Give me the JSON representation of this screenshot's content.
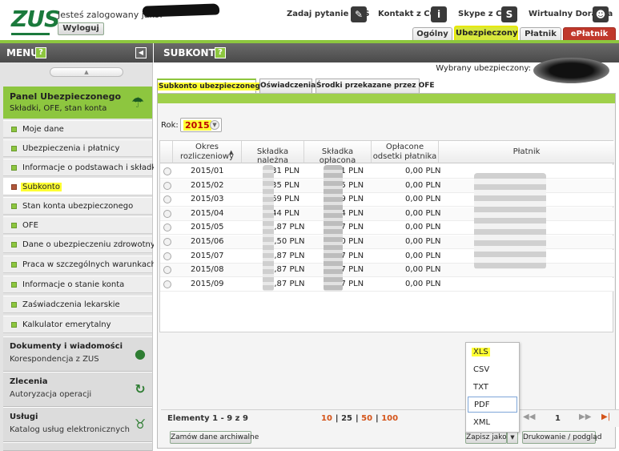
{
  "header": {
    "logo": "ZUS",
    "logged_as": "Jesteś zalogowany jako:",
    "logout": "Wyloguj",
    "links": [
      {
        "label": "Zadaj pytanie ZUS",
        "icon": "chat-icon"
      },
      {
        "label": "Kontakt z COT",
        "icon": "info-icon"
      },
      {
        "label": "Skype z COT",
        "icon": "skype-icon"
      },
      {
        "label": "Wirtualny Doradca",
        "icon": "user-icon"
      }
    ],
    "tabs": [
      "Ogólny",
      "Ubezpieczony",
      "Płatnik",
      "ePłatnik"
    ],
    "active_tab": "Ubezpieczony"
  },
  "menu": {
    "title": "MENU",
    "help": "?",
    "panel": {
      "title": "Panel Ubezpieczonego",
      "subtitle": "Składki, OFE, stan konta",
      "icon": "umbrella-icon"
    },
    "items": [
      "Moje dane",
      "Ubezpieczenia i płatnicy",
      "Informacje o podstawach i składkach",
      "Subkonto",
      "Stan konta ubezpieczonego",
      "OFE",
      "Dane o ubezpieczeniu zdrowotnym",
      "Praca w szczególnych warunkach",
      "Informacje o stanie konta",
      "Zaświadczenia lekarskie",
      "Kalkulator emerytalny"
    ],
    "active_item": "Subkonto",
    "groups": [
      {
        "title": "Dokumenty i wiadomości",
        "subtitle": "Korespondencja z ZUS",
        "icon": "speech-bubble-icon"
      },
      {
        "title": "Zlecenia",
        "subtitle": "Autoryzacja operacji",
        "icon": "refresh-icon"
      },
      {
        "title": "Usługi",
        "subtitle": "Katalog usług elektronicznych",
        "icon": "services-icon"
      }
    ]
  },
  "main": {
    "title": "SUBKONTO",
    "help": "?",
    "selected_label": "Wybrany ubezpieczony:",
    "subtabs": [
      "Subkonto ubezpieczonego *",
      "Oświadczenia",
      "Środki przekazane przez OFE"
    ],
    "rok_label": "Rok:",
    "rok_value": "2015",
    "columns": [
      "Okres rozliczeniowy",
      "Składka należna",
      "Składka opłacona",
      "Opłacone odsetki płatnika",
      "Płatnik"
    ],
    "rows": [
      {
        "okres": "2015/01",
        "nalezna": ",31 PLN",
        "oplacona": ",31 PLN",
        "odsetki": "0,00 PLN"
      },
      {
        "okres": "2015/02",
        "nalezna": ",35 PLN",
        "oplacona": ",35 PLN",
        "odsetki": "0,00 PLN"
      },
      {
        "okres": "2015/03",
        "nalezna": ",69 PLN",
        "oplacona": ",69 PLN",
        "odsetki": "0,00 PLN"
      },
      {
        "okres": "2015/04",
        "nalezna": ",44 PLN",
        "oplacona": ",44 PLN",
        "odsetki": "0,00 PLN"
      },
      {
        "okres": "2015/05",
        "nalezna": "6,87 PLN",
        "oplacona": ",87 PLN",
        "odsetki": "0,00 PLN"
      },
      {
        "okres": "2015/06",
        "nalezna": "4,50 PLN",
        "oplacona": ",80 PLN",
        "odsetki": "0,00 PLN"
      },
      {
        "okres": "2015/07",
        "nalezna": "6,87 PLN",
        "oplacona": ",87 PLN",
        "odsetki": "0,00 PLN"
      },
      {
        "okres": "2015/08",
        "nalezna": "6,87 PLN",
        "oplacona": ",87 PLN",
        "odsetki": "0,00 PLN"
      },
      {
        "okres": "2015/09",
        "nalezna": "6,87 PLN",
        "oplacona": ",87 PLN",
        "odsetki": "0,00 PLN"
      }
    ],
    "save_options": [
      "XLS",
      "CSV",
      "TXT",
      "PDF",
      "XML"
    ],
    "elements": "Elementy 1 - 9 z 9",
    "page_sizes": [
      "10",
      "25",
      "50",
      "100"
    ],
    "current_page_size": "25",
    "page": "1",
    "archive_btn": "Zamów dane archiwalne",
    "save_btn": "Zapisz jako",
    "print_btn": "Drukowanie / podgląd"
  }
}
